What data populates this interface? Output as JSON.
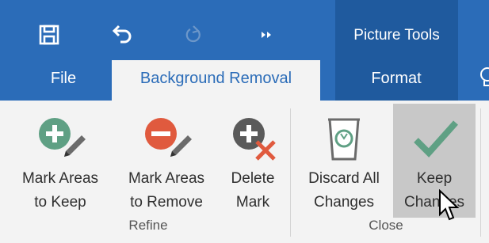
{
  "qat": {
    "save_icon": "save-icon",
    "undo_icon": "undo-icon",
    "redo_icon": "redo-icon",
    "more_icon": "more-commands-icon"
  },
  "context_group": {
    "label": "Picture Tools"
  },
  "tabs": [
    {
      "label": "File"
    },
    {
      "label": "Background Removal"
    },
    {
      "label": "Format"
    }
  ],
  "groups": {
    "refine": {
      "label": "Refine"
    },
    "close": {
      "label": "Close"
    }
  },
  "buttons": {
    "mark_keep": {
      "line1": "Mark Areas",
      "line2": "to Keep",
      "icon": "plus-pencil-icon"
    },
    "mark_remove": {
      "line1": "Mark Areas",
      "line2": "to Remove",
      "icon": "minus-pencil-icon"
    },
    "delete_mark": {
      "line1": "Delete",
      "line2": "Mark",
      "icon": "delete-mark-icon"
    },
    "discard": {
      "line1": "Discard All",
      "line2": "Changes",
      "icon": "recycle-bin-icon"
    },
    "keep": {
      "line1": "Keep",
      "line2": "Changes",
      "icon": "checkmark-icon"
    }
  },
  "colors": {
    "titlebar": "#2b6cb8",
    "context": "#1f5a9e",
    "green": "#5fa084",
    "red": "#e05a3e",
    "grey_icon": "#5a5a5a"
  }
}
